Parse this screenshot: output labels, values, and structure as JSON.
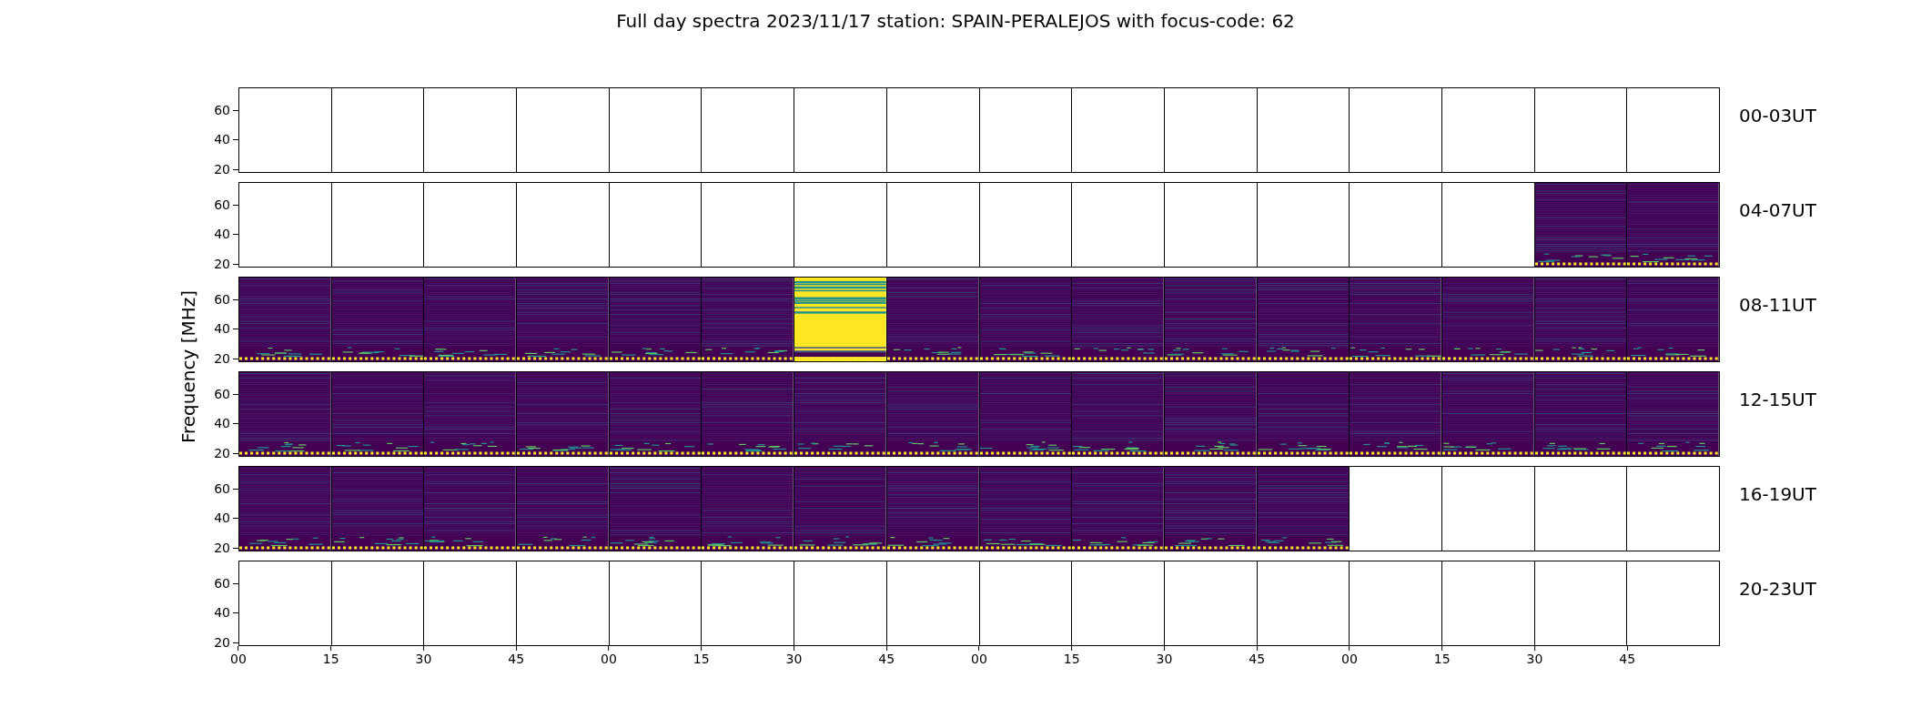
{
  "title": "Full day spectra 2023/11/17 station: SPAIN-PERALEJOS with focus-code: 62",
  "ylabel": "Frequency [MHz]",
  "rows": [
    {
      "label": "00-03UT",
      "yticks": [
        "60",
        "40",
        "20"
      ],
      "panels": [
        {
          "kind": "empty"
        },
        {
          "kind": "empty"
        },
        {
          "kind": "empty"
        },
        {
          "kind": "empty"
        },
        {
          "kind": "empty"
        },
        {
          "kind": "empty"
        },
        {
          "kind": "empty"
        },
        {
          "kind": "empty"
        },
        {
          "kind": "empty"
        },
        {
          "kind": "empty"
        },
        {
          "kind": "empty"
        },
        {
          "kind": "empty"
        },
        {
          "kind": "empty"
        },
        {
          "kind": "empty"
        },
        {
          "kind": "empty"
        },
        {
          "kind": "empty"
        }
      ]
    },
    {
      "label": "04-07UT",
      "yticks": [
        "60",
        "40",
        "20"
      ],
      "panels": [
        {
          "kind": "empty"
        },
        {
          "kind": "empty"
        },
        {
          "kind": "empty"
        },
        {
          "kind": "empty"
        },
        {
          "kind": "empty"
        },
        {
          "kind": "empty"
        },
        {
          "kind": "empty"
        },
        {
          "kind": "empty"
        },
        {
          "kind": "empty"
        },
        {
          "kind": "empty"
        },
        {
          "kind": "empty"
        },
        {
          "kind": "empty"
        },
        {
          "kind": "empty"
        },
        {
          "kind": "empty"
        },
        {
          "kind": "spectrum"
        },
        {
          "kind": "spectrum"
        }
      ]
    },
    {
      "label": "08-11UT",
      "yticks": [
        "60",
        "40",
        "20"
      ],
      "panels": [
        {
          "kind": "spectrum"
        },
        {
          "kind": "spectrum"
        },
        {
          "kind": "spectrum"
        },
        {
          "kind": "spectrum"
        },
        {
          "kind": "spectrum"
        },
        {
          "kind": "spectrum"
        },
        {
          "kind": "saturated"
        },
        {
          "kind": "spectrum"
        },
        {
          "kind": "spectrum"
        },
        {
          "kind": "spectrum"
        },
        {
          "kind": "spectrum"
        },
        {
          "kind": "spectrum"
        },
        {
          "kind": "spectrum"
        },
        {
          "kind": "spectrum"
        },
        {
          "kind": "spectrum"
        },
        {
          "kind": "spectrum"
        }
      ]
    },
    {
      "label": "12-15UT",
      "yticks": [
        "60",
        "40",
        "20"
      ],
      "panels": [
        {
          "kind": "spectrum"
        },
        {
          "kind": "spectrum"
        },
        {
          "kind": "spectrum"
        },
        {
          "kind": "spectrum"
        },
        {
          "kind": "spectrum"
        },
        {
          "kind": "spectrum"
        },
        {
          "kind": "spectrum"
        },
        {
          "kind": "spectrum"
        },
        {
          "kind": "spectrum"
        },
        {
          "kind": "spectrum"
        },
        {
          "kind": "spectrum"
        },
        {
          "kind": "spectrum"
        },
        {
          "kind": "spectrum"
        },
        {
          "kind": "spectrum"
        },
        {
          "kind": "spectrum"
        },
        {
          "kind": "spectrum"
        }
      ]
    },
    {
      "label": "16-19UT",
      "yticks": [
        "60",
        "40",
        "20"
      ],
      "panels": [
        {
          "kind": "spectrum"
        },
        {
          "kind": "spectrum"
        },
        {
          "kind": "spectrum"
        },
        {
          "kind": "spectrum"
        },
        {
          "kind": "spectrum"
        },
        {
          "kind": "spectrum"
        },
        {
          "kind": "spectrum"
        },
        {
          "kind": "spectrum"
        },
        {
          "kind": "spectrum"
        },
        {
          "kind": "spectrum"
        },
        {
          "kind": "spectrum"
        },
        {
          "kind": "spectrum"
        },
        {
          "kind": "empty"
        },
        {
          "kind": "empty"
        },
        {
          "kind": "empty"
        },
        {
          "kind": "empty"
        }
      ]
    },
    {
      "label": "20-23UT",
      "yticks": [
        "60",
        "40",
        "20"
      ],
      "panels": [
        {
          "kind": "empty"
        },
        {
          "kind": "empty"
        },
        {
          "kind": "empty"
        },
        {
          "kind": "empty"
        },
        {
          "kind": "empty"
        },
        {
          "kind": "empty"
        },
        {
          "kind": "empty"
        },
        {
          "kind": "empty"
        },
        {
          "kind": "empty"
        },
        {
          "kind": "empty"
        },
        {
          "kind": "empty"
        },
        {
          "kind": "empty"
        },
        {
          "kind": "empty"
        },
        {
          "kind": "empty"
        },
        {
          "kind": "empty"
        },
        {
          "kind": "empty"
        }
      ]
    }
  ],
  "xticks": [
    "00",
    "15",
    "30",
    "45",
    "00",
    "15",
    "30",
    "45",
    "00",
    "15",
    "30",
    "45",
    "00",
    "15",
    "30",
    "45"
  ]
}
